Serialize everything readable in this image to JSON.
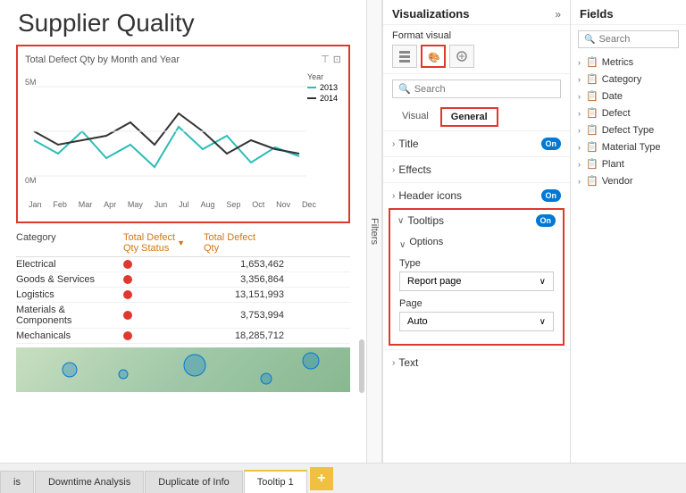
{
  "title": "Supplier Quality",
  "chart": {
    "title": "Total Defect Qty by Month and Year",
    "yMax": "5M",
    "yMin": "0M",
    "legend": {
      "yearLabel": "Year",
      "items": [
        {
          "label": "2013",
          "color": "#2dbcb6"
        },
        {
          "label": "2014",
          "color": "#333"
        }
      ]
    },
    "xLabels": [
      "Jan",
      "Feb",
      "Mar",
      "Apr",
      "May",
      "Jun",
      "Jul",
      "Aug",
      "Sep",
      "Oct",
      "Nov",
      "Dec"
    ]
  },
  "table": {
    "headers": {
      "category": "Category",
      "status": "Total Defect\nQty Status",
      "qty": "Total Defect\nQty"
    },
    "rows": [
      {
        "category": "Electrical",
        "qty": "1,653,462"
      },
      {
        "category": "Goods & Services",
        "qty": "3,356,864"
      },
      {
        "category": "Logistics",
        "qty": "13,151,993"
      },
      {
        "category": "Materials & Components",
        "qty": "3,753,994"
      },
      {
        "category": "Mechanicals",
        "qty": "18,285,712"
      }
    ]
  },
  "visualizations": {
    "title": "Visualizations",
    "format_visual_label": "Format visual",
    "search_placeholder": "Search",
    "tabs": [
      {
        "label": "Visual"
      },
      {
        "label": "General",
        "active": true
      }
    ],
    "sections": [
      {
        "label": "Title",
        "toggle": "On"
      },
      {
        "label": "Effects"
      },
      {
        "label": "Header icons",
        "toggle": "On"
      }
    ],
    "tooltips": {
      "label": "Tooltips",
      "toggle": "On",
      "options_label": "Options",
      "type_label": "Type",
      "type_value": "Report page",
      "page_label": "Page",
      "page_value": "Auto"
    },
    "text_section": {
      "label": "Text"
    }
  },
  "fields": {
    "title": "Fields",
    "search_placeholder": "Search",
    "items": [
      {
        "label": "Metrics"
      },
      {
        "label": "Category"
      },
      {
        "label": "Date"
      },
      {
        "label": "Defect"
      },
      {
        "label": "Defect Type"
      },
      {
        "label": "Material Type"
      },
      {
        "label": "Plant"
      },
      {
        "label": "Vendor"
      }
    ]
  },
  "filters_label": "Filters",
  "bottom_tabs": [
    {
      "label": "is"
    },
    {
      "label": "Downtime Analysis"
    },
    {
      "label": "Duplicate of Info"
    },
    {
      "label": "Tooltip 1"
    }
  ],
  "add_tab_label": "+"
}
